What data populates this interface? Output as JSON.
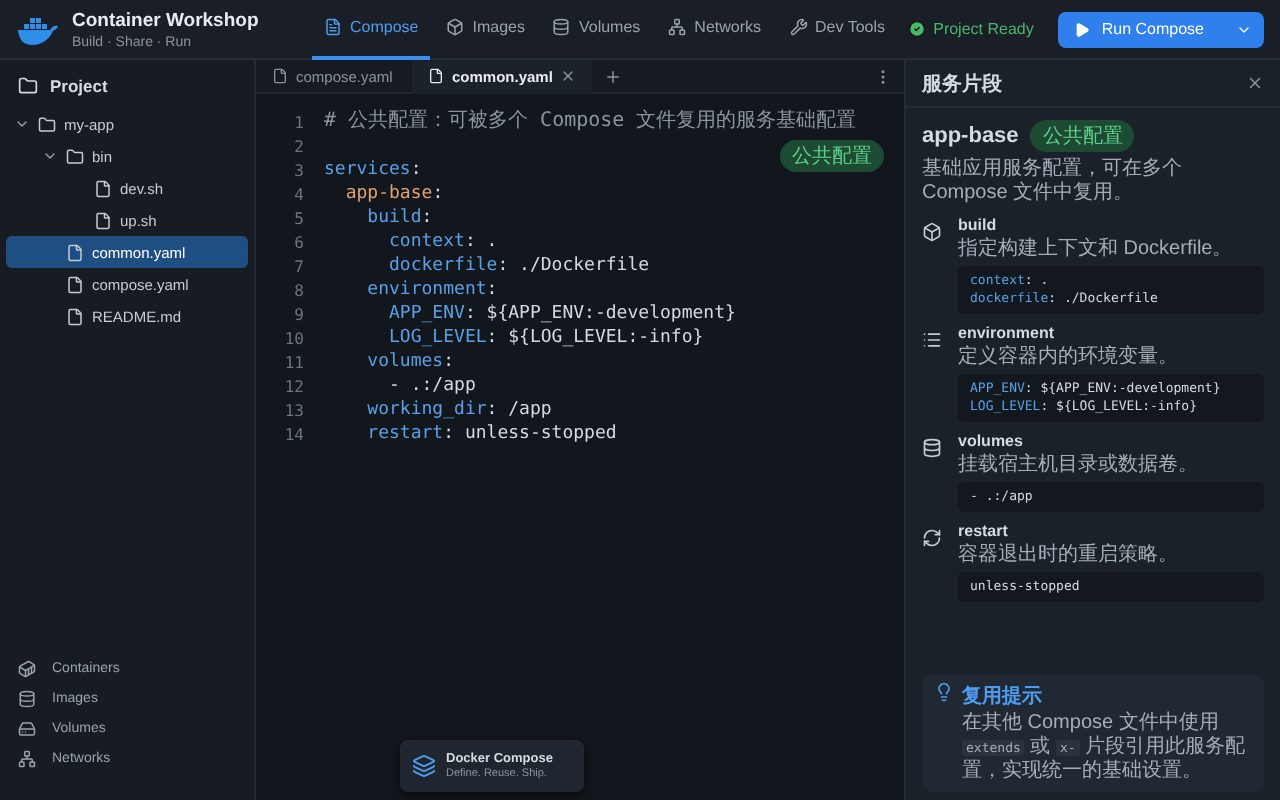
{
  "app": {
    "title": "Container Workshop",
    "subtitle": "Build · Share · Run"
  },
  "nav_tabs": [
    {
      "label": "Compose",
      "kind": "file",
      "selected": true
    },
    {
      "label": "Images",
      "kind": "box",
      "selected": false
    },
    {
      "label": "Volumes",
      "kind": "database",
      "selected": false
    },
    {
      "label": "Networks",
      "kind": "network",
      "selected": false
    },
    {
      "label": "Dev Tools",
      "kind": "wrench",
      "selected": false
    }
  ],
  "status": {
    "label": "Project Ready"
  },
  "run_button": {
    "label": "Run Compose"
  },
  "sidebar": {
    "title": "Project",
    "tree": [
      {
        "label": "my-app",
        "kind": "folder",
        "expanded": true,
        "selected": false,
        "children": [
          {
            "label": "bin",
            "kind": "folder",
            "expanded": true,
            "selected": false,
            "children": [
              {
                "label": "dev.sh",
                "kind": "file",
                "selected": false
              },
              {
                "label": "up.sh",
                "kind": "file",
                "selected": false
              }
            ]
          },
          {
            "label": "common.yaml",
            "kind": "file",
            "selected": true
          },
          {
            "label": "compose.yaml",
            "kind": "file",
            "selected": false
          },
          {
            "label": "README.md",
            "kind": "file",
            "selected": false
          }
        ]
      }
    ],
    "nav": [
      {
        "label": "Containers",
        "kind": "containers"
      },
      {
        "label": "Images",
        "kind": "images"
      },
      {
        "label": "Volumes",
        "kind": "volumes"
      },
      {
        "label": "Networks",
        "kind": "networks"
      }
    ]
  },
  "editor": {
    "tabs": [
      {
        "label": "compose.yaml",
        "selected": false,
        "closable": false
      },
      {
        "label": "common.yaml",
        "selected": true,
        "closable": true
      }
    ],
    "badge": "公共配置",
    "lines": [
      {
        "number": "1",
        "tokens": [
          {
            "t": "# 公共配置：可被多个 Compose 文件复用的服务基础配置",
            "kind": "comment"
          }
        ]
      },
      {
        "number": "2"
      },
      {
        "number": "3",
        "tokens": [
          {
            "t": "services",
            "kind": "key"
          },
          {
            "t": ":",
            "kind": "text"
          }
        ]
      },
      {
        "number": "4",
        "tokens": [
          {
            "t": "  app-base",
            "kind": "service"
          },
          {
            "t": ":",
            "kind": "text"
          }
        ]
      },
      {
        "number": "5",
        "tokens": [
          {
            "t": "    build",
            "kind": "key"
          },
          {
            "t": ":",
            "kind": "text"
          }
        ]
      },
      {
        "number": "6",
        "tokens": [
          {
            "t": "      context",
            "kind": "key"
          },
          {
            "t": ": .",
            "kind": "text"
          }
        ]
      },
      {
        "number": "7",
        "tokens": [
          {
            "t": "      dockerfile",
            "kind": "key"
          },
          {
            "t": ": ./Dockerfile",
            "kind": "text"
          }
        ]
      },
      {
        "number": "8",
        "tokens": [
          {
            "t": "    environment",
            "kind": "key"
          },
          {
            "t": ":",
            "kind": "text"
          }
        ]
      },
      {
        "number": "9",
        "tokens": [
          {
            "t": "      APP_ENV",
            "kind": "key"
          },
          {
            "t": ": ${APP_ENV:-development}",
            "kind": "text"
          }
        ]
      },
      {
        "number": "10",
        "tokens": [
          {
            "t": "      LOG_LEVEL",
            "kind": "key"
          },
          {
            "t": ": ${LOG_LEVEL:-info}",
            "kind": "text"
          }
        ]
      },
      {
        "number": "11",
        "tokens": [
          {
            "t": "    volumes",
            "kind": "key"
          },
          {
            "t": ":",
            "kind": "text"
          }
        ]
      },
      {
        "number": "12",
        "tokens": [
          {
            "t": "      - .:/app",
            "kind": "text"
          }
        ]
      },
      {
        "number": "13",
        "tokens": [
          {
            "t": "    working_dir",
            "kind": "key"
          },
          {
            "t": ": /app",
            "kind": "text"
          }
        ]
      },
      {
        "number": "14",
        "tokens": [
          {
            "t": "    restart",
            "kind": "key"
          },
          {
            "t": ": unless-stopped",
            "kind": "text"
          }
        ]
      }
    ]
  },
  "panel": {
    "title": "服务片段",
    "service": "app-base",
    "badge": "公共配置",
    "description": "基础应用服务配置，可在多个 Compose 文件中复用。",
    "sections": [
      {
        "kind": "build",
        "name": "build",
        "description": "指定构建上下文和 Dockerfile。",
        "code": [
          [
            {
              "t": "context",
              "kind": "key"
            },
            {
              "t": ": .",
              "kind": "text"
            }
          ],
          [
            {
              "t": "dockerfile",
              "kind": "key"
            },
            {
              "t": ": ./Dockerfile",
              "kind": "text"
            }
          ]
        ]
      },
      {
        "kind": "environment",
        "name": "environment",
        "description": "定义容器内的环境变量。",
        "code": [
          [
            {
              "t": "APP_ENV",
              "kind": "key"
            },
            {
              "t": ": ${APP_ENV:-development}",
              "kind": "text"
            }
          ],
          [
            {
              "t": "LOG_LEVEL",
              "kind": "key"
            },
            {
              "t": ": ${LOG_LEVEL:-info}",
              "kind": "text"
            }
          ]
        ]
      },
      {
        "kind": "volumes",
        "name": "volumes",
        "description": "挂载宿主机目录或数据卷。",
        "code": [
          [
            {
              "t": "- .:/app",
              "kind": "text"
            }
          ]
        ]
      },
      {
        "kind": "restart",
        "name": "restart",
        "description": "容器退出时的重启策略。",
        "code": [
          [
            {
              "t": "unless-stopped",
              "kind": "text"
            }
          ]
        ]
      }
    ],
    "tip": {
      "title": "复用提示",
      "segments": [
        {
          "t": "在其他 Compose 文件中使用 ",
          "code": false
        },
        {
          "t": "extends",
          "code": true
        },
        {
          "t": " 或 ",
          "code": false
        },
        {
          "t": "x-",
          "code": true
        },
        {
          "t": " 片段引用此服务配置，实现统一的基础设置。",
          "code": false
        }
      ]
    }
  },
  "toast": {
    "title": "Docker Compose",
    "subtitle": "Define. Reuse. Ship."
  }
}
